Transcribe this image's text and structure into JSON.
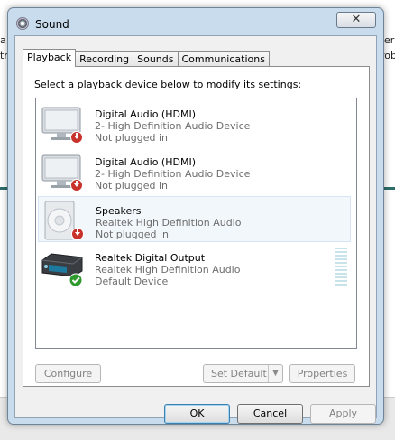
{
  "background": {
    "fragments": [
      "a",
      "tra",
      "er,",
      "rob"
    ]
  },
  "window": {
    "title": "Sound",
    "close_glyph": "✕"
  },
  "tabs": [
    {
      "label": "Playback",
      "active": true
    },
    {
      "label": "Recording",
      "active": false
    },
    {
      "label": "Sounds",
      "active": false
    },
    {
      "label": "Communications",
      "active": false
    }
  ],
  "playback": {
    "instruction": "Select a playback device below to modify its settings:",
    "devices": [
      {
        "name": "Digital Audio (HDMI)",
        "desc": "2- High Definition Audio Device",
        "status": "Not plugged in",
        "icon": "monitor-icon",
        "badge": "red-down-arrow-icon"
      },
      {
        "name": "Digital Audio (HDMI)",
        "desc": "2- High Definition Audio Device",
        "status": "Not plugged in",
        "icon": "monitor-icon",
        "badge": "red-down-arrow-icon"
      },
      {
        "name": "Speakers",
        "desc": "Realtek High Definition Audio",
        "status": "Not plugged in",
        "icon": "speaker-icon",
        "badge": "red-down-arrow-icon",
        "selected": true
      },
      {
        "name": "Realtek Digital Output",
        "desc": "Realtek High Definition Audio",
        "status": "Default Device",
        "icon": "receiver-icon",
        "badge": "green-check-icon"
      }
    ],
    "configure_label": "Configure",
    "set_default_label": "Set Default",
    "properties_label": "Properties"
  },
  "buttons": {
    "ok": "OK",
    "cancel": "Cancel",
    "apply": "Apply"
  },
  "colors": {
    "window_frame": "#c9dced",
    "selected_row": "#f2f7fc",
    "badge_red": "#c8322b",
    "badge_green": "#2e9a2e"
  }
}
